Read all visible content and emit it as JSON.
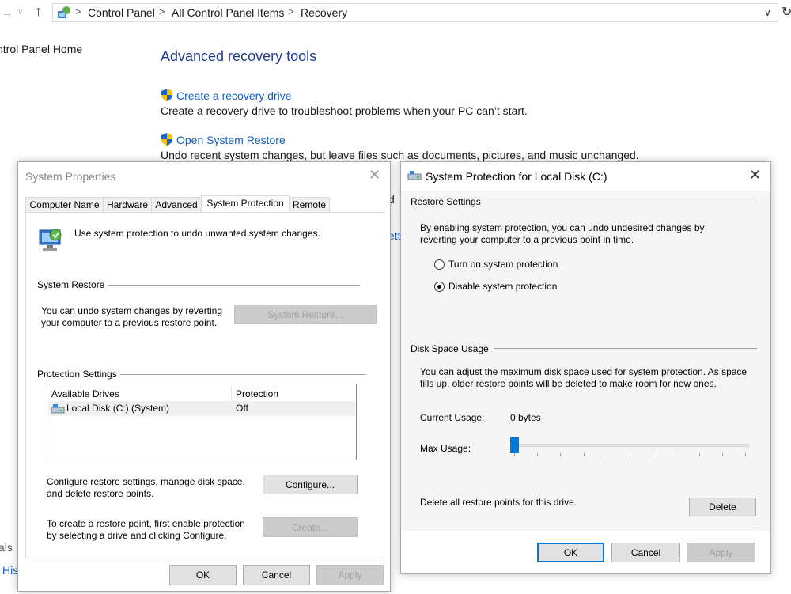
{
  "explorer": {
    "breadcrumb": [
      "Control Panel",
      "All Control Panel Items",
      "Recovery"
    ]
  },
  "control_panel": {
    "home_link": "ntrol Panel Home",
    "heading": "Advanced recovery tools",
    "tools": [
      {
        "link": "Create a recovery drive",
        "desc": "Create a recovery drive to troubleshoot problems when your PC can’t start."
      },
      {
        "link": "Open System Restore",
        "desc": "Undo recent system changes, but leave files such as documents, pictures, and music unchanged."
      }
    ],
    "partial_fragments": {
      "d": "d",
      "ett": "ett",
      "also": "als",
      "his": "His"
    }
  },
  "system_properties": {
    "title": "System Properties",
    "tabs": [
      "Computer Name",
      "Hardware",
      "Advanced",
      "System Protection",
      "Remote"
    ],
    "intro": "Use system protection to undo unwanted system changes.",
    "restore_group": "System Restore",
    "restore_text": [
      "You can undo system changes by reverting",
      "your computer to a previous restore point."
    ],
    "restore_button": "System Restore...",
    "protection_group": "Protection Settings",
    "columns": [
      "Available Drives",
      "Protection"
    ],
    "drives": [
      {
        "name": "Local Disk (C:) (System)",
        "protection": "Off"
      }
    ],
    "configure_text": [
      "Configure restore settings, manage disk space,",
      "and delete restore points."
    ],
    "configure_button": "Configure...",
    "create_text": [
      "To create a restore point, first enable protection",
      "by selecting a drive and clicking Configure."
    ],
    "create_button": "Create...",
    "ok": "OK",
    "cancel": "Cancel",
    "apply": "Apply"
  },
  "protection_dialog": {
    "title": "System Protection for Local Disk (C:)",
    "restore_group": "Restore Settings",
    "restore_text": [
      "By enabling system protection, you can undo undesired changes by",
      "reverting your computer to a previous point in time."
    ],
    "option_on": "Turn on system protection",
    "option_off": "Disable system protection",
    "selected_option": "Disable system protection",
    "disk_group": "Disk Space Usage",
    "disk_text": [
      "You can adjust the maximum disk space used for system protection. As space",
      "fills up, older restore points will be deleted to make room for new ones."
    ],
    "current_usage_label": "Current Usage:",
    "current_usage_value": "0 bytes",
    "max_usage_label": "Max Usage:",
    "max_usage_fraction": 0,
    "delete_text": "Delete all restore points for this drive.",
    "delete_button": "Delete",
    "ok": "OK",
    "cancel": "Cancel",
    "apply": "Apply"
  },
  "colors": {
    "link": "#1560bd",
    "heading": "#1e3d8f",
    "accent": "#0078d7"
  }
}
